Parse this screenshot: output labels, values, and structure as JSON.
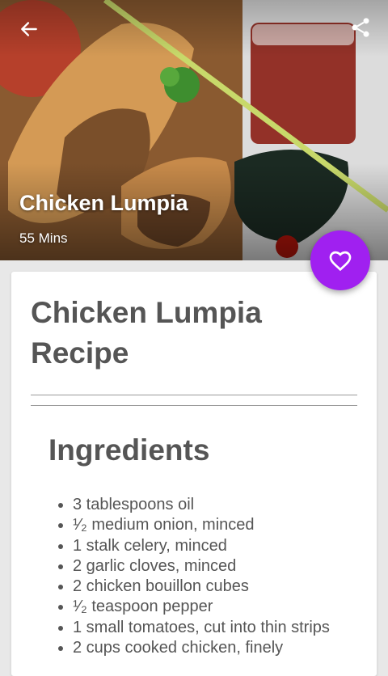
{
  "header": {
    "back_icon": "arrow-left-icon",
    "share_icon": "share-icon",
    "title": "Chicken Lumpia",
    "time": "55 Mins"
  },
  "favorite": {
    "icon": "heart-outline-icon",
    "color": "#a020f0"
  },
  "recipe": {
    "title": "Chicken Lumpia Recipe",
    "ingredients_heading": "Ingredients",
    "ingredients": [
      "3 tablespoons oil",
      "¹⁄₂ medium onion, minced",
      "1 stalk celery, minced",
      "2 garlic cloves, minced",
      "2 chicken bouillon cubes",
      "¹⁄₂ teaspoon pepper",
      "1 small tomatoes, cut into thin strips",
      "2 cups cooked chicken, finely"
    ]
  }
}
